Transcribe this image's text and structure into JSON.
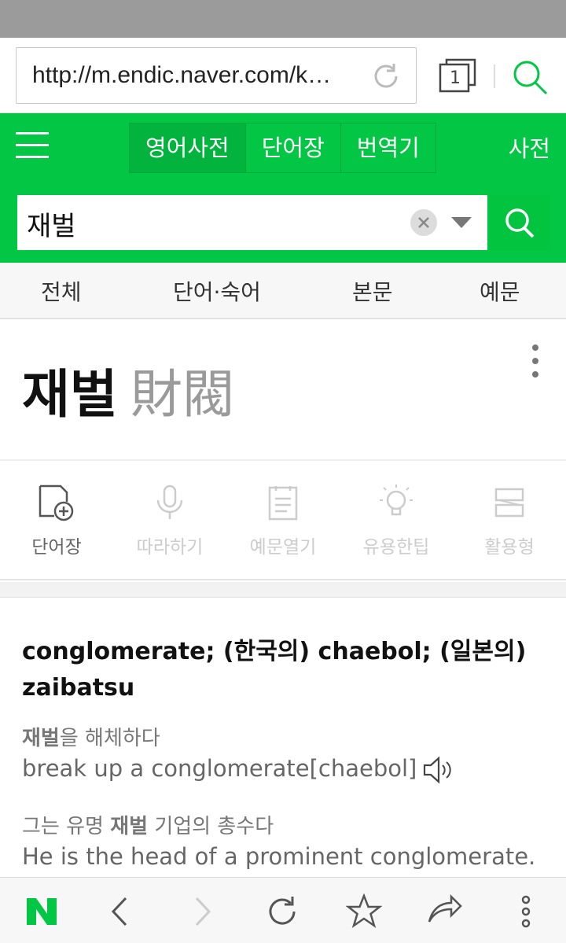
{
  "browser": {
    "url": "http://m.endic.naver.com/k…",
    "tab_count": "1"
  },
  "header": {
    "tabs": [
      "영어사전",
      "단어장",
      "번역기"
    ],
    "dict_link": "사전"
  },
  "search": {
    "query": "재벌"
  },
  "filters": [
    "전체",
    "단어·숙어",
    "본문",
    "예문"
  ],
  "entry": {
    "word": "재벌",
    "hanja": "財閥"
  },
  "tools": [
    "단어장",
    "따라하기",
    "예문열기",
    "유용한팁",
    "활용형"
  ],
  "meaning": "conglomerate; (한국의) chaebol; (일본의) zaibatsu",
  "examples": [
    {
      "ko_bold": "재벌",
      "ko_rest": "을 해체하다",
      "en": "break up a conglomerate[chaebol]"
    },
    {
      "ko_pre": "그는 유명 ",
      "ko_bold": "재벌",
      "ko_rest": " 기업의 총수다",
      "en": "He is the head of a prominent conglomerate."
    }
  ],
  "colors": {
    "brand_green": "#03c744",
    "status_bar": "#9b9b9b"
  }
}
